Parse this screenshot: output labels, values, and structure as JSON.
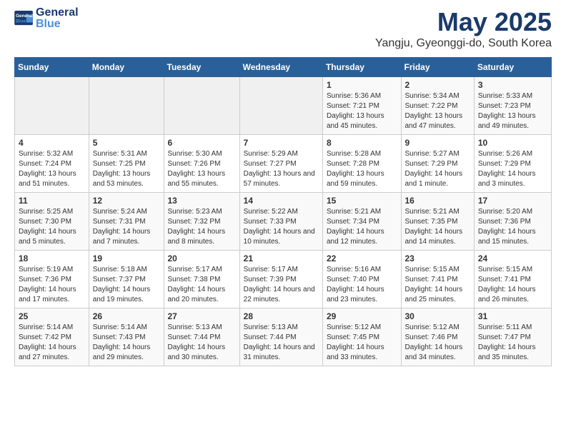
{
  "logo": {
    "line1": "General",
    "line2": "Blue"
  },
  "title": "May 2025",
  "subtitle": "Yangju, Gyeonggi-do, South Korea",
  "weekdays": [
    "Sunday",
    "Monday",
    "Tuesday",
    "Wednesday",
    "Thursday",
    "Friday",
    "Saturday"
  ],
  "weeks": [
    [
      {
        "day": "",
        "empty": true
      },
      {
        "day": "",
        "empty": true
      },
      {
        "day": "",
        "empty": true
      },
      {
        "day": "",
        "empty": true
      },
      {
        "day": "1",
        "sunrise": "5:36 AM",
        "sunset": "7:21 PM",
        "daylight": "13 hours and 45 minutes."
      },
      {
        "day": "2",
        "sunrise": "5:34 AM",
        "sunset": "7:22 PM",
        "daylight": "13 hours and 47 minutes."
      },
      {
        "day": "3",
        "sunrise": "5:33 AM",
        "sunset": "7:23 PM",
        "daylight": "13 hours and 49 minutes."
      }
    ],
    [
      {
        "day": "4",
        "sunrise": "5:32 AM",
        "sunset": "7:24 PM",
        "daylight": "13 hours and 51 minutes."
      },
      {
        "day": "5",
        "sunrise": "5:31 AM",
        "sunset": "7:25 PM",
        "daylight": "13 hours and 53 minutes."
      },
      {
        "day": "6",
        "sunrise": "5:30 AM",
        "sunset": "7:26 PM",
        "daylight": "13 hours and 55 minutes."
      },
      {
        "day": "7",
        "sunrise": "5:29 AM",
        "sunset": "7:27 PM",
        "daylight": "13 hours and 57 minutes."
      },
      {
        "day": "8",
        "sunrise": "5:28 AM",
        "sunset": "7:28 PM",
        "daylight": "13 hours and 59 minutes."
      },
      {
        "day": "9",
        "sunrise": "5:27 AM",
        "sunset": "7:29 PM",
        "daylight": "14 hours and 1 minute."
      },
      {
        "day": "10",
        "sunrise": "5:26 AM",
        "sunset": "7:29 PM",
        "daylight": "14 hours and 3 minutes."
      }
    ],
    [
      {
        "day": "11",
        "sunrise": "5:25 AM",
        "sunset": "7:30 PM",
        "daylight": "14 hours and 5 minutes."
      },
      {
        "day": "12",
        "sunrise": "5:24 AM",
        "sunset": "7:31 PM",
        "daylight": "14 hours and 7 minutes."
      },
      {
        "day": "13",
        "sunrise": "5:23 AM",
        "sunset": "7:32 PM",
        "daylight": "14 hours and 8 minutes."
      },
      {
        "day": "14",
        "sunrise": "5:22 AM",
        "sunset": "7:33 PM",
        "daylight": "14 hours and 10 minutes."
      },
      {
        "day": "15",
        "sunrise": "5:21 AM",
        "sunset": "7:34 PM",
        "daylight": "14 hours and 12 minutes."
      },
      {
        "day": "16",
        "sunrise": "5:21 AM",
        "sunset": "7:35 PM",
        "daylight": "14 hours and 14 minutes."
      },
      {
        "day": "17",
        "sunrise": "5:20 AM",
        "sunset": "7:36 PM",
        "daylight": "14 hours and 15 minutes."
      }
    ],
    [
      {
        "day": "18",
        "sunrise": "5:19 AM",
        "sunset": "7:36 PM",
        "daylight": "14 hours and 17 minutes."
      },
      {
        "day": "19",
        "sunrise": "5:18 AM",
        "sunset": "7:37 PM",
        "daylight": "14 hours and 19 minutes."
      },
      {
        "day": "20",
        "sunrise": "5:17 AM",
        "sunset": "7:38 PM",
        "daylight": "14 hours and 20 minutes."
      },
      {
        "day": "21",
        "sunrise": "5:17 AM",
        "sunset": "7:39 PM",
        "daylight": "14 hours and 22 minutes."
      },
      {
        "day": "22",
        "sunrise": "5:16 AM",
        "sunset": "7:40 PM",
        "daylight": "14 hours and 23 minutes."
      },
      {
        "day": "23",
        "sunrise": "5:15 AM",
        "sunset": "7:41 PM",
        "daylight": "14 hours and 25 minutes."
      },
      {
        "day": "24",
        "sunrise": "5:15 AM",
        "sunset": "7:41 PM",
        "daylight": "14 hours and 26 minutes."
      }
    ],
    [
      {
        "day": "25",
        "sunrise": "5:14 AM",
        "sunset": "7:42 PM",
        "daylight": "14 hours and 27 minutes."
      },
      {
        "day": "26",
        "sunrise": "5:14 AM",
        "sunset": "7:43 PM",
        "daylight": "14 hours and 29 minutes."
      },
      {
        "day": "27",
        "sunrise": "5:13 AM",
        "sunset": "7:44 PM",
        "daylight": "14 hours and 30 minutes."
      },
      {
        "day": "28",
        "sunrise": "5:13 AM",
        "sunset": "7:44 PM",
        "daylight": "14 hours and 31 minutes."
      },
      {
        "day": "29",
        "sunrise": "5:12 AM",
        "sunset": "7:45 PM",
        "daylight": "14 hours and 33 minutes."
      },
      {
        "day": "30",
        "sunrise": "5:12 AM",
        "sunset": "7:46 PM",
        "daylight": "14 hours and 34 minutes."
      },
      {
        "day": "31",
        "sunrise": "5:11 AM",
        "sunset": "7:47 PM",
        "daylight": "14 hours and 35 minutes."
      }
    ]
  ]
}
